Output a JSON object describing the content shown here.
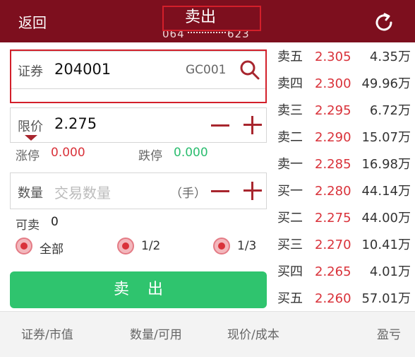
{
  "header": {
    "back_label": "返回",
    "title": "卖出",
    "account_prefix": "064",
    "account_suffix": "623"
  },
  "security": {
    "label": "证券",
    "code": "204001",
    "name": "GC001"
  },
  "price": {
    "label": "限价",
    "value": "2.275",
    "limit_up_label": "涨停",
    "limit_up_value": "0.000",
    "limit_down_label": "跌停",
    "limit_down_value": "0.000"
  },
  "quantity": {
    "label": "数量",
    "placeholder": "交易数量",
    "unit": "（手）",
    "sellable_label": "可卖",
    "sellable_value": "0"
  },
  "portions": [
    "全部",
    "1/2",
    "1/3"
  ],
  "sell_button_label": "卖出",
  "order_book": [
    {
      "label": "卖五",
      "price": "2.305",
      "volume": "4.35万"
    },
    {
      "label": "卖四",
      "price": "2.300",
      "volume": "49.96万"
    },
    {
      "label": "卖三",
      "price": "2.295",
      "volume": "6.72万"
    },
    {
      "label": "卖二",
      "price": "2.290",
      "volume": "15.07万"
    },
    {
      "label": "卖一",
      "price": "2.285",
      "volume": "16.98万"
    },
    {
      "label": "买一",
      "price": "2.280",
      "volume": "44.14万"
    },
    {
      "label": "买二",
      "price": "2.275",
      "volume": "44.00万"
    },
    {
      "label": "买三",
      "price": "2.270",
      "volume": "10.41万"
    },
    {
      "label": "买四",
      "price": "2.265",
      "volume": "4.01万"
    },
    {
      "label": "买五",
      "price": "2.260",
      "volume": "57.01万"
    }
  ],
  "footer_columns": [
    "证券/市值",
    "数量/可用",
    "现价/成本",
    "盈亏"
  ],
  "colors": {
    "header_bg": "#7d0f1e",
    "price_red": "#d9323a",
    "limit_down_green": "#2bbd6f",
    "sell_button_green": "#2fc46e"
  }
}
